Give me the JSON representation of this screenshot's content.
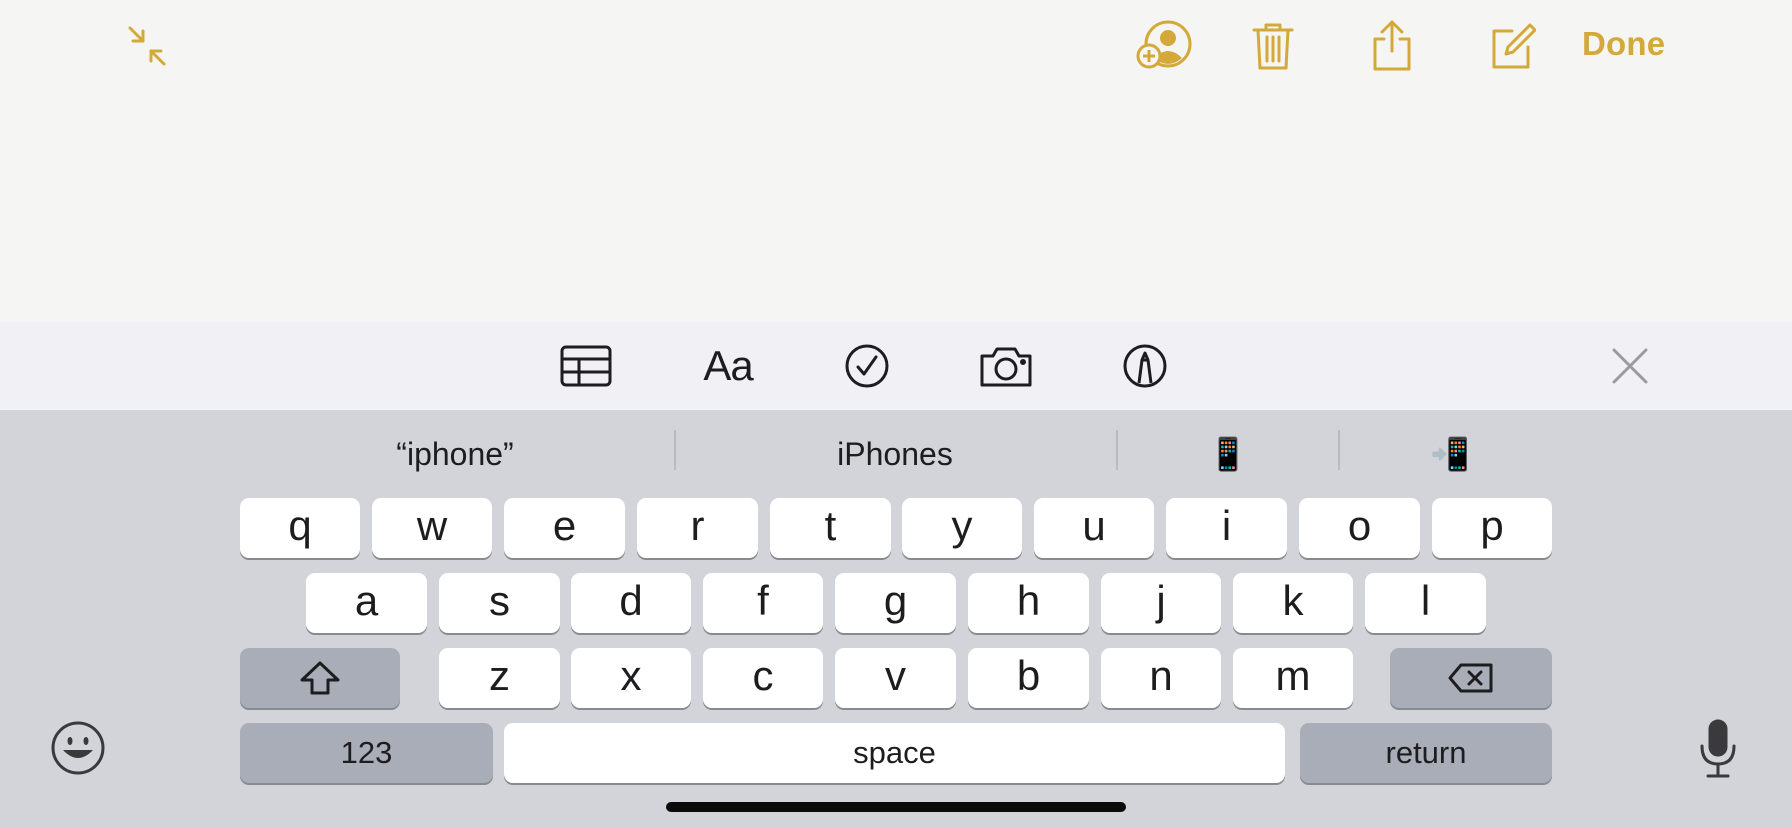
{
  "header": {
    "done_label": "Done",
    "accent_color": "#d4a93a",
    "icons": [
      "collapse-icon",
      "add-person-icon",
      "trash-icon",
      "share-icon",
      "compose-icon"
    ]
  },
  "toolbar": {
    "format_label": "Aa",
    "icons": [
      "table-icon",
      "format-icon",
      "checklist-icon",
      "camera-icon",
      "markup-icon",
      "close-icon"
    ]
  },
  "predictions": [
    "“iphone”",
    "iPhones",
    "📱",
    "📲"
  ],
  "keyboard": {
    "row1": [
      "q",
      "w",
      "e",
      "r",
      "t",
      "y",
      "u",
      "i",
      "o",
      "p"
    ],
    "row2": [
      "a",
      "s",
      "d",
      "f",
      "g",
      "h",
      "j",
      "k",
      "l"
    ],
    "row3": [
      "z",
      "x",
      "c",
      "v",
      "b",
      "n",
      "m"
    ],
    "numbers_label": "123",
    "space_label": "space",
    "return_label": "return",
    "icons": [
      "shift-icon",
      "delete-icon",
      "emoji-icon",
      "microphone-icon"
    ]
  }
}
